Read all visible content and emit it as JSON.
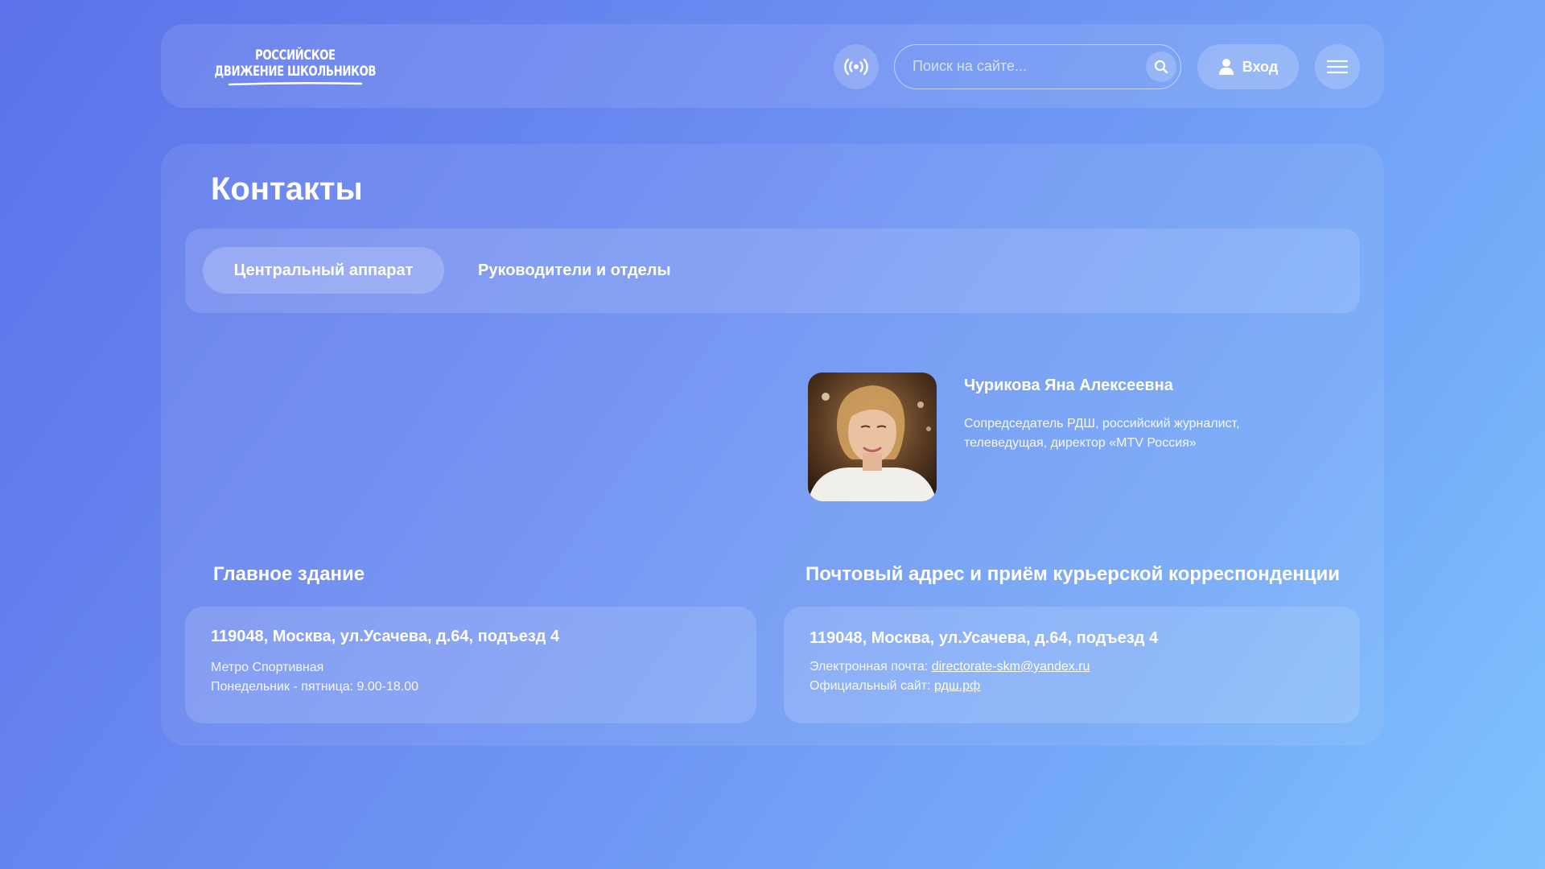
{
  "header": {
    "logo": {
      "line1": "Российское",
      "line2": "Движение школьников"
    },
    "search": {
      "placeholder": "Поиск на сайте..."
    },
    "login_label": "Вход"
  },
  "page": {
    "title": "Контакты",
    "tabs": [
      {
        "label": "Центральный аппарат",
        "active": true
      },
      {
        "label": "Руководители и отделы",
        "active": false
      }
    ]
  },
  "person": {
    "name": "Чурикова Яна Алексеевна",
    "description": "Сопредседатель РДШ, российский журналист, телеведущая, директор «MTV Россия»"
  },
  "main_building": {
    "title": "Главное здание",
    "address": "119048, Москва, ул.Усачева, д.64, подъезд 4",
    "metro": "Метро Спортивная",
    "hours": "Понедельник - пятница: 9.00-18.00"
  },
  "postal": {
    "title": "Почтовый адрес и приём курьерской корреспонденции",
    "address": "119048, Москва, ул.Усачева, д.64, подъезд 4",
    "email_label": "Электронная почта:",
    "email": "directorate-skm@yandex.ru",
    "site_label": "Официальный сайт:",
    "site": "рдш.рф"
  },
  "colors": {
    "background_start": "#5b72ea",
    "background_end": "#7ec3fd",
    "text": "#ffffff"
  },
  "icons": [
    "logo-mark-icon",
    "broadcast-icon",
    "search-icon",
    "user-icon",
    "hamburger-menu-icon"
  ]
}
